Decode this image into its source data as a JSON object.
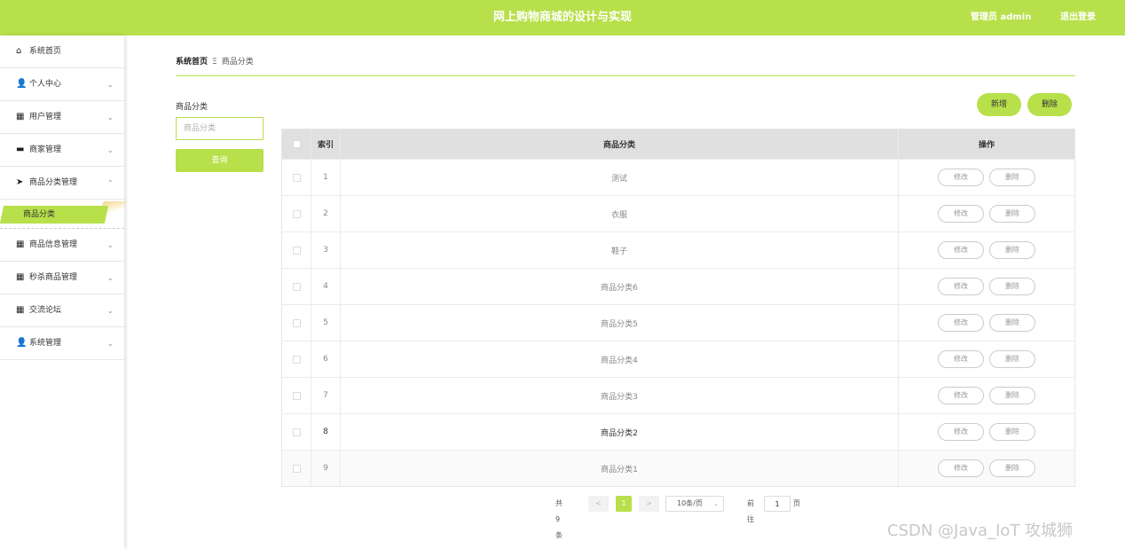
{
  "header": {
    "title": "网上购物商城的设计与实现",
    "user": "管理员 admin",
    "logout": "退出登录",
    "accent_color": "#b8e04a"
  },
  "sidebar": {
    "items": [
      {
        "label": "系统首页",
        "icon": "home-icon",
        "glyph": "⌂",
        "arrow": ""
      },
      {
        "label": "个人中心",
        "icon": "user-icon",
        "glyph": "👤",
        "arrow": "⌄"
      },
      {
        "label": "用户管理",
        "icon": "grid-icon",
        "glyph": "▦",
        "arrow": "⌄"
      },
      {
        "label": "商家管理",
        "icon": "monitor-icon",
        "glyph": "▬",
        "arrow": "⌄"
      },
      {
        "label": "商品分类管理",
        "icon": "send-icon",
        "glyph": "➤",
        "arrow": "⌃"
      },
      {
        "label": "商品信息管理",
        "icon": "grid-icon",
        "glyph": "▦",
        "arrow": "⌄"
      },
      {
        "label": "秒杀商品管理",
        "icon": "apps-icon",
        "glyph": "▦",
        "arrow": "⌄"
      },
      {
        "label": "交流论坛",
        "icon": "grid9-icon",
        "glyph": "▦",
        "arrow": "⌄"
      },
      {
        "label": "系统管理",
        "icon": "user-icon",
        "glyph": "👤",
        "arrow": "⌄"
      }
    ],
    "active_sub": "商品分类"
  },
  "breadcrumb": {
    "home": "系统首页",
    "separator": "Ξ",
    "current": "商品分类"
  },
  "filter": {
    "label": "商品分类",
    "placeholder": "商品分类",
    "search_button": "查询"
  },
  "actions": {
    "add": "新增",
    "delete": "删除"
  },
  "table": {
    "columns": [
      "索引",
      "商品分类",
      "操作"
    ],
    "rows": [
      {
        "index": "1",
        "name": "测试"
      },
      {
        "index": "2",
        "name": "衣服"
      },
      {
        "index": "3",
        "name": "鞋子"
      },
      {
        "index": "4",
        "name": "商品分类6"
      },
      {
        "index": "5",
        "name": "商品分类5"
      },
      {
        "index": "6",
        "name": "商品分类4"
      },
      {
        "index": "7",
        "name": "商品分类3"
      },
      {
        "index": "8",
        "name": "商品分类2"
      },
      {
        "index": "9",
        "name": "商品分类1"
      }
    ],
    "edit_label": "修改",
    "delete_label": "删除"
  },
  "pagination": {
    "total": "共 9 条",
    "prev": "<",
    "current_page": "1",
    "next": ">",
    "page_size": "10条/页",
    "goto_label": "前往",
    "goto_value": "1",
    "goto_unit": "页"
  },
  "watermark": "CSDN @Java_IoT 攻城狮"
}
